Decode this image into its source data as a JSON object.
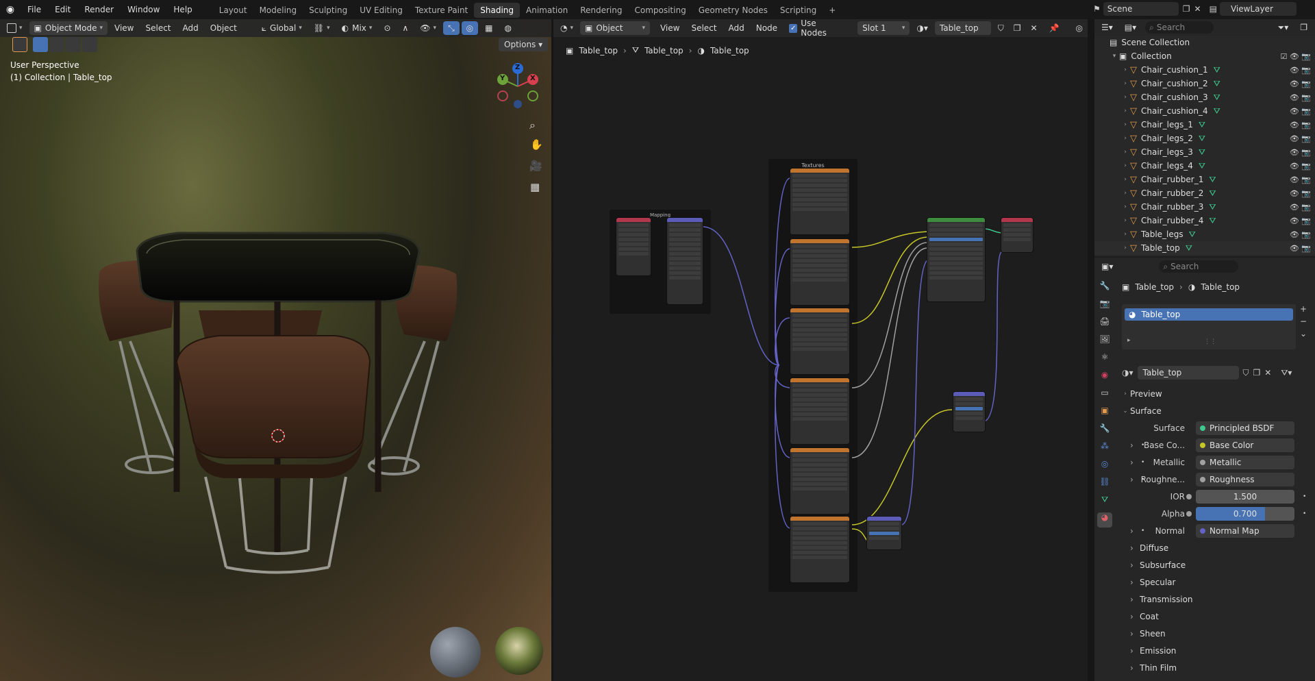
{
  "menu": {
    "items": [
      "File",
      "Edit",
      "Render",
      "Window",
      "Help"
    ],
    "workspaces": [
      "Layout",
      "Modeling",
      "Sculpting",
      "UV Editing",
      "Texture Paint",
      "Shading",
      "Animation",
      "Rendering",
      "Compositing",
      "Geometry Nodes",
      "Scripting"
    ],
    "active_workspace": "Shading",
    "add_tab": "+",
    "scene": "Scene",
    "view_layer": "ViewLayer"
  },
  "viewport": {
    "mode": "Object Mode",
    "menus": [
      "View",
      "Select",
      "Add",
      "Object"
    ],
    "orientation": "Global",
    "snap_mix": "Mix",
    "options": "Options",
    "overlay_title": "User Perspective",
    "overlay_subtitle": "(1) Collection | Table_top",
    "gizmo": {
      "z": "Z",
      "y": "Y",
      "x": "X"
    }
  },
  "node_editor": {
    "type": "Object",
    "menus": [
      "View",
      "Select",
      "Add",
      "Node"
    ],
    "use_nodes_label": "Use Nodes",
    "use_nodes": true,
    "slot": "Slot 1",
    "material": "Table_top",
    "breadcrumb": [
      "Table_top",
      "Table_top",
      "Table_top"
    ],
    "frames": {
      "mapping": "Mapping",
      "textures": "Textures"
    }
  },
  "outliner": {
    "search_placeholder": "Search",
    "scene_collection": "Scene Collection",
    "collection": "Collection",
    "objects": [
      "Chair_cushion_1",
      "Chair_cushion_2",
      "Chair_cushion_3",
      "Chair_cushion_4",
      "Chair_legs_1",
      "Chair_legs_2",
      "Chair_legs_3",
      "Chair_legs_4",
      "Chair_rubber_1",
      "Chair_rubber_2",
      "Chair_rubber_3",
      "Chair_rubber_4",
      "Table_legs",
      "Table_top"
    ]
  },
  "properties": {
    "search_placeholder": "Search",
    "breadcrumb": [
      "Table_top",
      "Table_top"
    ],
    "material_slot": "Table_top",
    "material_name": "Table_top",
    "panels": {
      "preview": "Preview",
      "surface": "Surface"
    },
    "surface": {
      "label": "Surface",
      "value": "Principled BSDF"
    },
    "inputs": [
      {
        "label": "Base Co...",
        "value": "Base Color",
        "color": "#c7c729"
      },
      {
        "label": "Metallic",
        "value": "Metallic",
        "color": "#a1a1a1"
      },
      {
        "label": "Roughne...",
        "value": "Roughness",
        "color": "#a1a1a1"
      }
    ],
    "ior": {
      "label": "IOR",
      "value": "1.500"
    },
    "alpha": {
      "label": "Alpha",
      "value": "0.700",
      "fraction": 0.7
    },
    "normal": {
      "label": "Normal",
      "value": "Normal Map"
    },
    "subpanels": [
      "Diffuse",
      "Subsurface",
      "Specular",
      "Transmission",
      "Coat",
      "Sheen",
      "Emission",
      "Thin Film"
    ]
  },
  "colors": {
    "accent": "#4772b3",
    "active_tab": "#303030",
    "selection": "#4772b3"
  }
}
